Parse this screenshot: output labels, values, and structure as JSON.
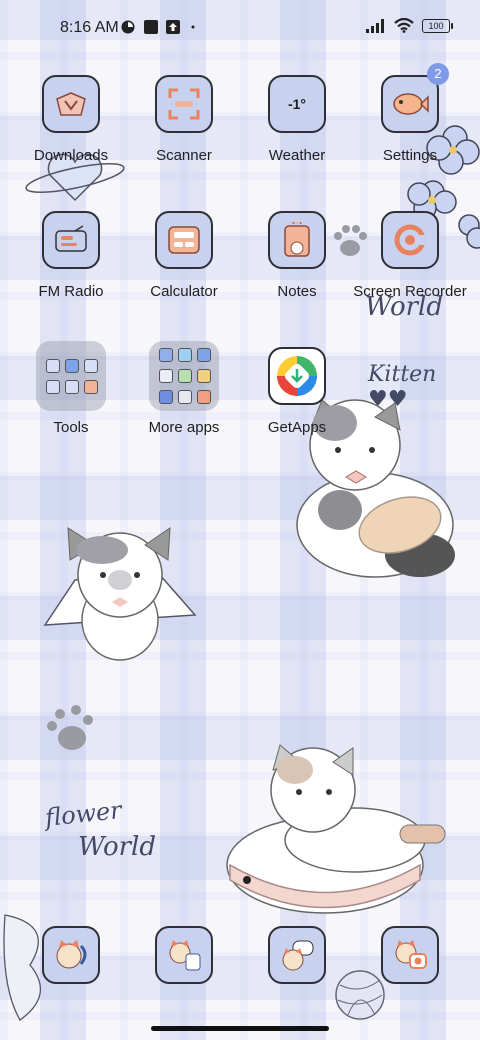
{
  "status_bar": {
    "time": "8:16 AM",
    "battery": "100",
    "icons": [
      "browser-icon",
      "notification-square-icon",
      "upload-icon",
      "dot-icon",
      "signal-icon",
      "wifi-icon",
      "battery-icon"
    ]
  },
  "apps": {
    "row1": [
      {
        "label": "Downloads"
      },
      {
        "label": "Scanner"
      },
      {
        "label": "Weather",
        "tile_text": "-1°"
      },
      {
        "label": "Settings",
        "badge": "2"
      }
    ],
    "row2": [
      {
        "label": "FM Radio"
      },
      {
        "label": "Calculator"
      },
      {
        "label": "Notes"
      },
      {
        "label": "Screen Recorder"
      }
    ],
    "row3": [
      {
        "label": "Tools"
      },
      {
        "label": "More apps"
      },
      {
        "label": "GetApps"
      }
    ]
  },
  "wallpaper_text": {
    "world_top": "World",
    "kitten": "Kitten ♥♥",
    "flower": "flower",
    "world_bottom": "World"
  },
  "dock": [
    {
      "icon": "phone-cat-icon"
    },
    {
      "icon": "contacts-cat-icon"
    },
    {
      "icon": "messages-cat-icon"
    },
    {
      "icon": "camera-cat-icon"
    }
  ],
  "colors": {
    "tile": "#c8d2ef",
    "badge": "#7f9be8",
    "accent_orange": "#e9825f"
  }
}
